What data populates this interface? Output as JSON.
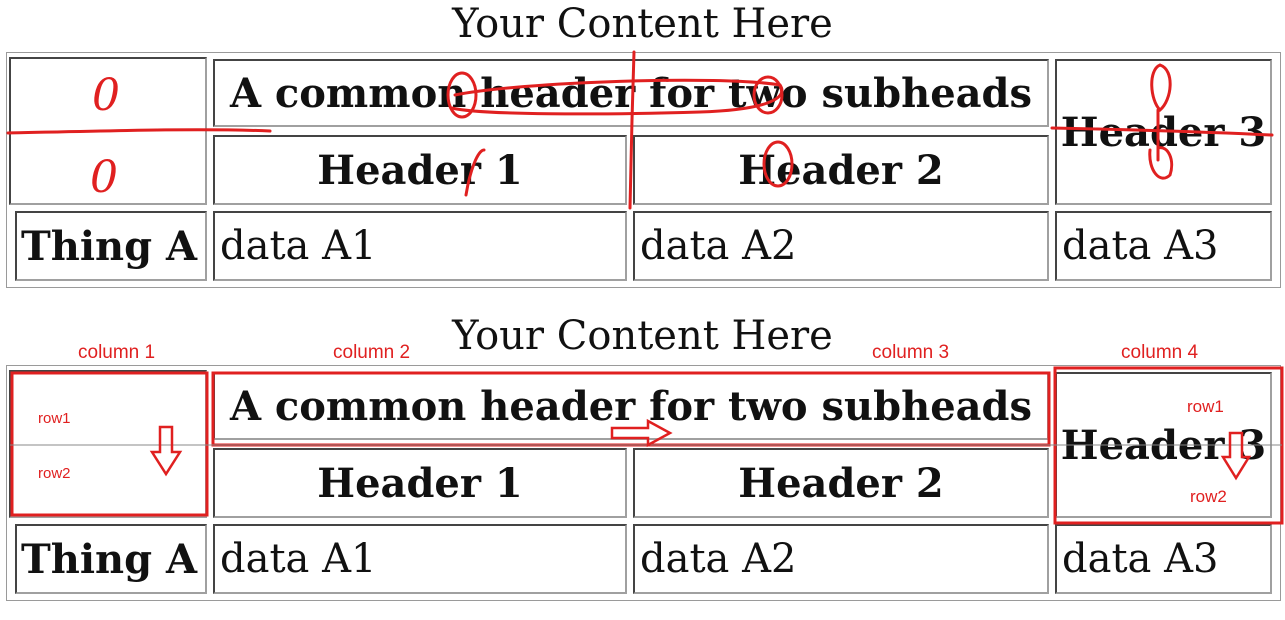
{
  "tables": [
    {
      "caption": "Your Content Here",
      "header_common": "A common header for two subheads",
      "header1": "Header 1",
      "header2": "Header 2",
      "header3": "Header 3",
      "row_label": "Thing A",
      "data": [
        "data A1",
        "data A2",
        "data A3"
      ]
    },
    {
      "caption": "Your Content Here",
      "header_common": "A common header for two subheads",
      "header1": "Header 1",
      "header2": "Header 2",
      "header3": "Header 3",
      "row_label": "Thing A",
      "data": [
        "data A1",
        "data A2",
        "data A3"
      ]
    }
  ],
  "annotations_top": {
    "zero_left_top": "0",
    "zero_left_bottom": "0"
  },
  "annotations_bottom": {
    "column1": "column 1",
    "column2": "column 2",
    "column3": "column 3",
    "column4": "column 4",
    "left_row1": "row1",
    "left_row2": "row2",
    "right_row1": "row1",
    "right_row2": "row2"
  },
  "colors": {
    "annotation": "#e02020",
    "grid_border": "#a0a0a0"
  }
}
